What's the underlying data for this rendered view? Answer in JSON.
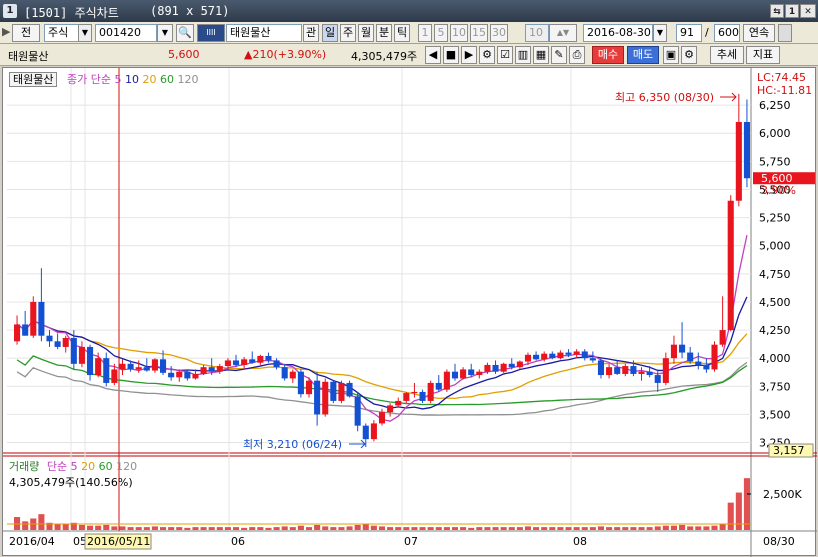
{
  "window": {
    "screen_no": "1",
    "title": "[1501] 주식차트",
    "size_text": "(891 x 571)",
    "buttons": [
      "⇆",
      "1",
      "E",
      "✕"
    ]
  },
  "toolbar": {
    "prev": "전",
    "market": "주식",
    "code": "001420",
    "name": "태원물산",
    "tab_kwan": "관",
    "periods": [
      "일",
      "주",
      "월",
      "분",
      "틱"
    ],
    "minutes": [
      "1",
      "5",
      "10",
      "15",
      "30"
    ],
    "min_value": "10",
    "date": "2016-08-30",
    "count": "91",
    "total": "600",
    "continuous": "연속",
    "buy": "매수",
    "sell": "매도",
    "add": "추세",
    "index": "지표"
  },
  "info": {
    "name": "태원물산",
    "price": "5,600",
    "change": "▲210(+3.90%)",
    "volume": "4,305,479주"
  },
  "legend_price": {
    "name": "태원물산",
    "label": "종가 단순",
    "ma": [
      "5",
      "10",
      "20",
      "60",
      "120"
    ]
  },
  "legend_volume": {
    "name": "거래량",
    "label": "단순",
    "ma": [
      "5",
      "20",
      "60",
      "120"
    ],
    "value": "4,305,479주(140.56%)"
  },
  "colors": {
    "up": "#e8141e",
    "down": "#1450d2",
    "ma5": "#c040c0",
    "ma10": "#1a1aa0",
    "ma20": "#e0a000",
    "ma60": "#2a9a2a",
    "ma120": "#909090",
    "crosshair": "#d01010",
    "volume": "#e05050"
  },
  "chart_data": {
    "type": "candlestick",
    "y_axis_ticks": [
      "6,250",
      "6,000",
      "5,750",
      "5,500",
      "5,250",
      "5,000",
      "4,750",
      "4,500",
      "4,250",
      "4,000",
      "3,750",
      "3,500",
      "3,250"
    ],
    "y_range": [
      3157,
      6420
    ],
    "lc_label": "LC:74.45",
    "hc_label": "HC:-11.81",
    "current_price": "5,600",
    "current_pct": "3.90%",
    "low_label": "3,157",
    "high_annotation": "최고 6,350 (08/30)",
    "low_annotation": "최저 3,210 (06/24)",
    "volume_tick": "2,500K",
    "x_labels": [
      "2016/04",
      "05",
      "2016/05/11",
      "06",
      "07",
      "08",
      "08/30"
    ],
    "candles": [
      [
        4150,
        4380,
        4120,
        4300
      ],
      [
        4300,
        4420,
        4200,
        4200
      ],
      [
        4200,
        4550,
        4180,
        4500
      ],
      [
        4500,
        4800,
        4150,
        4200
      ],
      [
        4200,
        4250,
        4100,
        4150
      ],
      [
        4150,
        4220,
        4080,
        4100
      ],
      [
        4100,
        4200,
        4050,
        4180
      ],
      [
        4180,
        4250,
        3900,
        3950
      ],
      [
        3950,
        4150,
        3920,
        4100
      ],
      [
        4100,
        4120,
        3800,
        3850
      ],
      [
        3850,
        4050,
        3830,
        4000
      ],
      [
        4000,
        4050,
        3750,
        3780
      ],
      [
        3780,
        3950,
        3760,
        3900
      ],
      [
        3900,
        3990,
        3850,
        3950
      ],
      [
        3950,
        3980,
        3880,
        3900
      ],
      [
        3900,
        3980,
        3870,
        3920
      ],
      [
        3920,
        4000,
        3880,
        3890
      ],
      [
        3890,
        4000,
        3870,
        3990
      ],
      [
        3990,
        4070,
        3850,
        3870
      ],
      [
        3870,
        3930,
        3800,
        3830
      ],
      [
        3830,
        3900,
        3790,
        3880
      ],
      [
        3880,
        3900,
        3800,
        3820
      ],
      [
        3820,
        3900,
        3810,
        3860
      ],
      [
        3860,
        3940,
        3850,
        3920
      ],
      [
        3920,
        4000,
        3850,
        3880
      ],
      [
        3880,
        3950,
        3860,
        3930
      ],
      [
        3930,
        4000,
        3900,
        3980
      ],
      [
        3980,
        4030,
        3920,
        3940
      ],
      [
        3940,
        4010,
        3900,
        3990
      ],
      [
        3990,
        4060,
        3950,
        3960
      ],
      [
        3960,
        4030,
        3940,
        4020
      ],
      [
        4020,
        4050,
        3960,
        3980
      ],
      [
        3980,
        4000,
        3900,
        3920
      ],
      [
        3920,
        3950,
        3800,
        3820
      ],
      [
        3820,
        3900,
        3780,
        3880
      ],
      [
        3880,
        3900,
        3650,
        3680
      ],
      [
        3680,
        3830,
        3650,
        3800
      ],
      [
        3800,
        3880,
        3400,
        3500
      ],
      [
        3500,
        3820,
        3480,
        3790
      ],
      [
        3790,
        3800,
        3600,
        3620
      ],
      [
        3620,
        3800,
        3600,
        3780
      ],
      [
        3780,
        3800,
        3650,
        3660
      ],
      [
        3660,
        3700,
        3350,
        3400
      ],
      [
        3400,
        3420,
        3210,
        3280
      ],
      [
        3280,
        3450,
        3260,
        3420
      ],
      [
        3420,
        3550,
        3400,
        3520
      ],
      [
        3520,
        3600,
        3480,
        3580
      ],
      [
        3580,
        3650,
        3560,
        3620
      ],
      [
        3620,
        3700,
        3600,
        3690
      ],
      [
        3690,
        3780,
        3650,
        3700
      ],
      [
        3700,
        3720,
        3600,
        3620
      ],
      [
        3620,
        3800,
        3600,
        3780
      ],
      [
        3780,
        3850,
        3700,
        3720
      ],
      [
        3720,
        3900,
        3700,
        3880
      ],
      [
        3880,
        3950,
        3800,
        3820
      ],
      [
        3820,
        3920,
        3810,
        3900
      ],
      [
        3900,
        3950,
        3830,
        3850
      ],
      [
        3850,
        3900,
        3820,
        3880
      ],
      [
        3880,
        3960,
        3860,
        3940
      ],
      [
        3940,
        3980,
        3860,
        3880
      ],
      [
        3880,
        3960,
        3870,
        3950
      ],
      [
        3950,
        4000,
        3900,
        3920
      ],
      [
        3920,
        3980,
        3900,
        3970
      ],
      [
        3970,
        4050,
        3940,
        4030
      ],
      [
        4030,
        4060,
        3980,
        3990
      ],
      [
        3990,
        4060,
        3970,
        4040
      ],
      [
        4040,
        4060,
        3990,
        4000
      ],
      [
        4000,
        4070,
        3990,
        4050
      ],
      [
        4050,
        4080,
        4010,
        4030
      ],
      [
        4030,
        4080,
        4000,
        4060
      ],
      [
        4060,
        4080,
        3980,
        4000
      ],
      [
        4000,
        4060,
        3960,
        3980
      ],
      [
        3980,
        4000,
        3820,
        3850
      ],
      [
        3850,
        3950,
        3820,
        3920
      ],
      [
        3920,
        3980,
        3850,
        3860
      ],
      [
        3860,
        3950,
        3840,
        3930
      ],
      [
        3930,
        3980,
        3840,
        3860
      ],
      [
        3860,
        3920,
        3800,
        3880
      ],
      [
        3880,
        3930,
        3830,
        3850
      ],
      [
        3850,
        3900,
        3700,
        3780
      ],
      [
        3780,
        4050,
        3760,
        4000
      ],
      [
        4000,
        4200,
        3950,
        4120
      ],
      [
        4120,
        4320,
        4000,
        4050
      ],
      [
        4050,
        4100,
        3950,
        3970
      ],
      [
        3970,
        4050,
        3900,
        3940
      ],
      [
        3940,
        4000,
        3870,
        3900
      ],
      [
        3900,
        4150,
        3880,
        4120
      ],
      [
        4120,
        4550,
        4100,
        4250
      ],
      [
        4250,
        5450,
        4240,
        5400
      ],
      [
        5400,
        6350,
        5350,
        6100
      ],
      [
        6100,
        6300,
        5520,
        5600
      ]
    ],
    "volumes": [
      0.18,
      0.12,
      0.16,
      0.22,
      0.1,
      0.09,
      0.08,
      0.1,
      0.07,
      0.06,
      0.06,
      0.07,
      0.05,
      0.05,
      0.04,
      0.04,
      0.04,
      0.05,
      0.04,
      0.04,
      0.04,
      0.03,
      0.04,
      0.04,
      0.04,
      0.04,
      0.04,
      0.04,
      0.03,
      0.04,
      0.04,
      0.03,
      0.04,
      0.05,
      0.04,
      0.06,
      0.04,
      0.07,
      0.05,
      0.04,
      0.04,
      0.05,
      0.07,
      0.08,
      0.06,
      0.05,
      0.04,
      0.04,
      0.04,
      0.04,
      0.04,
      0.04,
      0.04,
      0.04,
      0.04,
      0.04,
      0.03,
      0.04,
      0.04,
      0.04,
      0.04,
      0.04,
      0.04,
      0.05,
      0.04,
      0.04,
      0.04,
      0.04,
      0.04,
      0.04,
      0.04,
      0.04,
      0.05,
      0.04,
      0.04,
      0.04,
      0.04,
      0.04,
      0.04,
      0.05,
      0.06,
      0.06,
      0.07,
      0.05,
      0.05,
      0.05,
      0.06,
      0.09,
      0.38,
      0.52,
      0.72
    ]
  }
}
